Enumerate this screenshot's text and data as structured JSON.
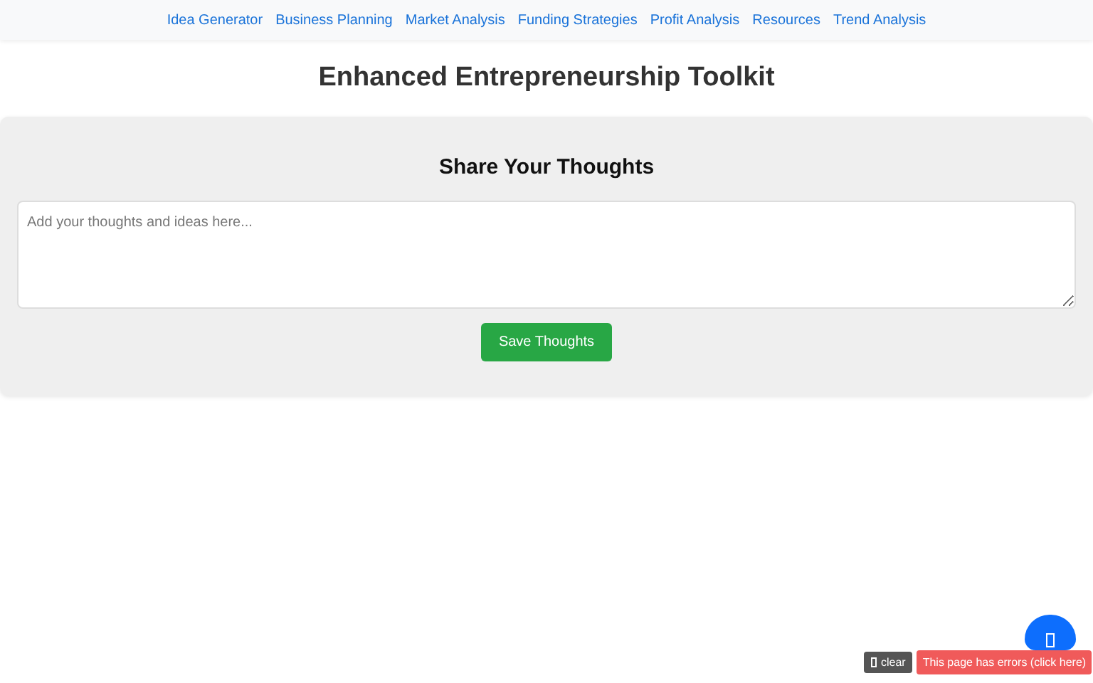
{
  "nav": {
    "links": [
      "Idea Generator",
      "Business Planning",
      "Market Analysis",
      "Funding Strategies",
      "Profit Analysis",
      "Resources",
      "Trend Analysis"
    ]
  },
  "title": "Enhanced Entrepreneurship Toolkit",
  "thoughts": {
    "heading": "Share Your Thoughts",
    "placeholder": "Add your thoughts and ideas here...",
    "button": "Save Thoughts"
  },
  "debug": {
    "clear": "clear",
    "errors": "This page has errors (click here)"
  }
}
